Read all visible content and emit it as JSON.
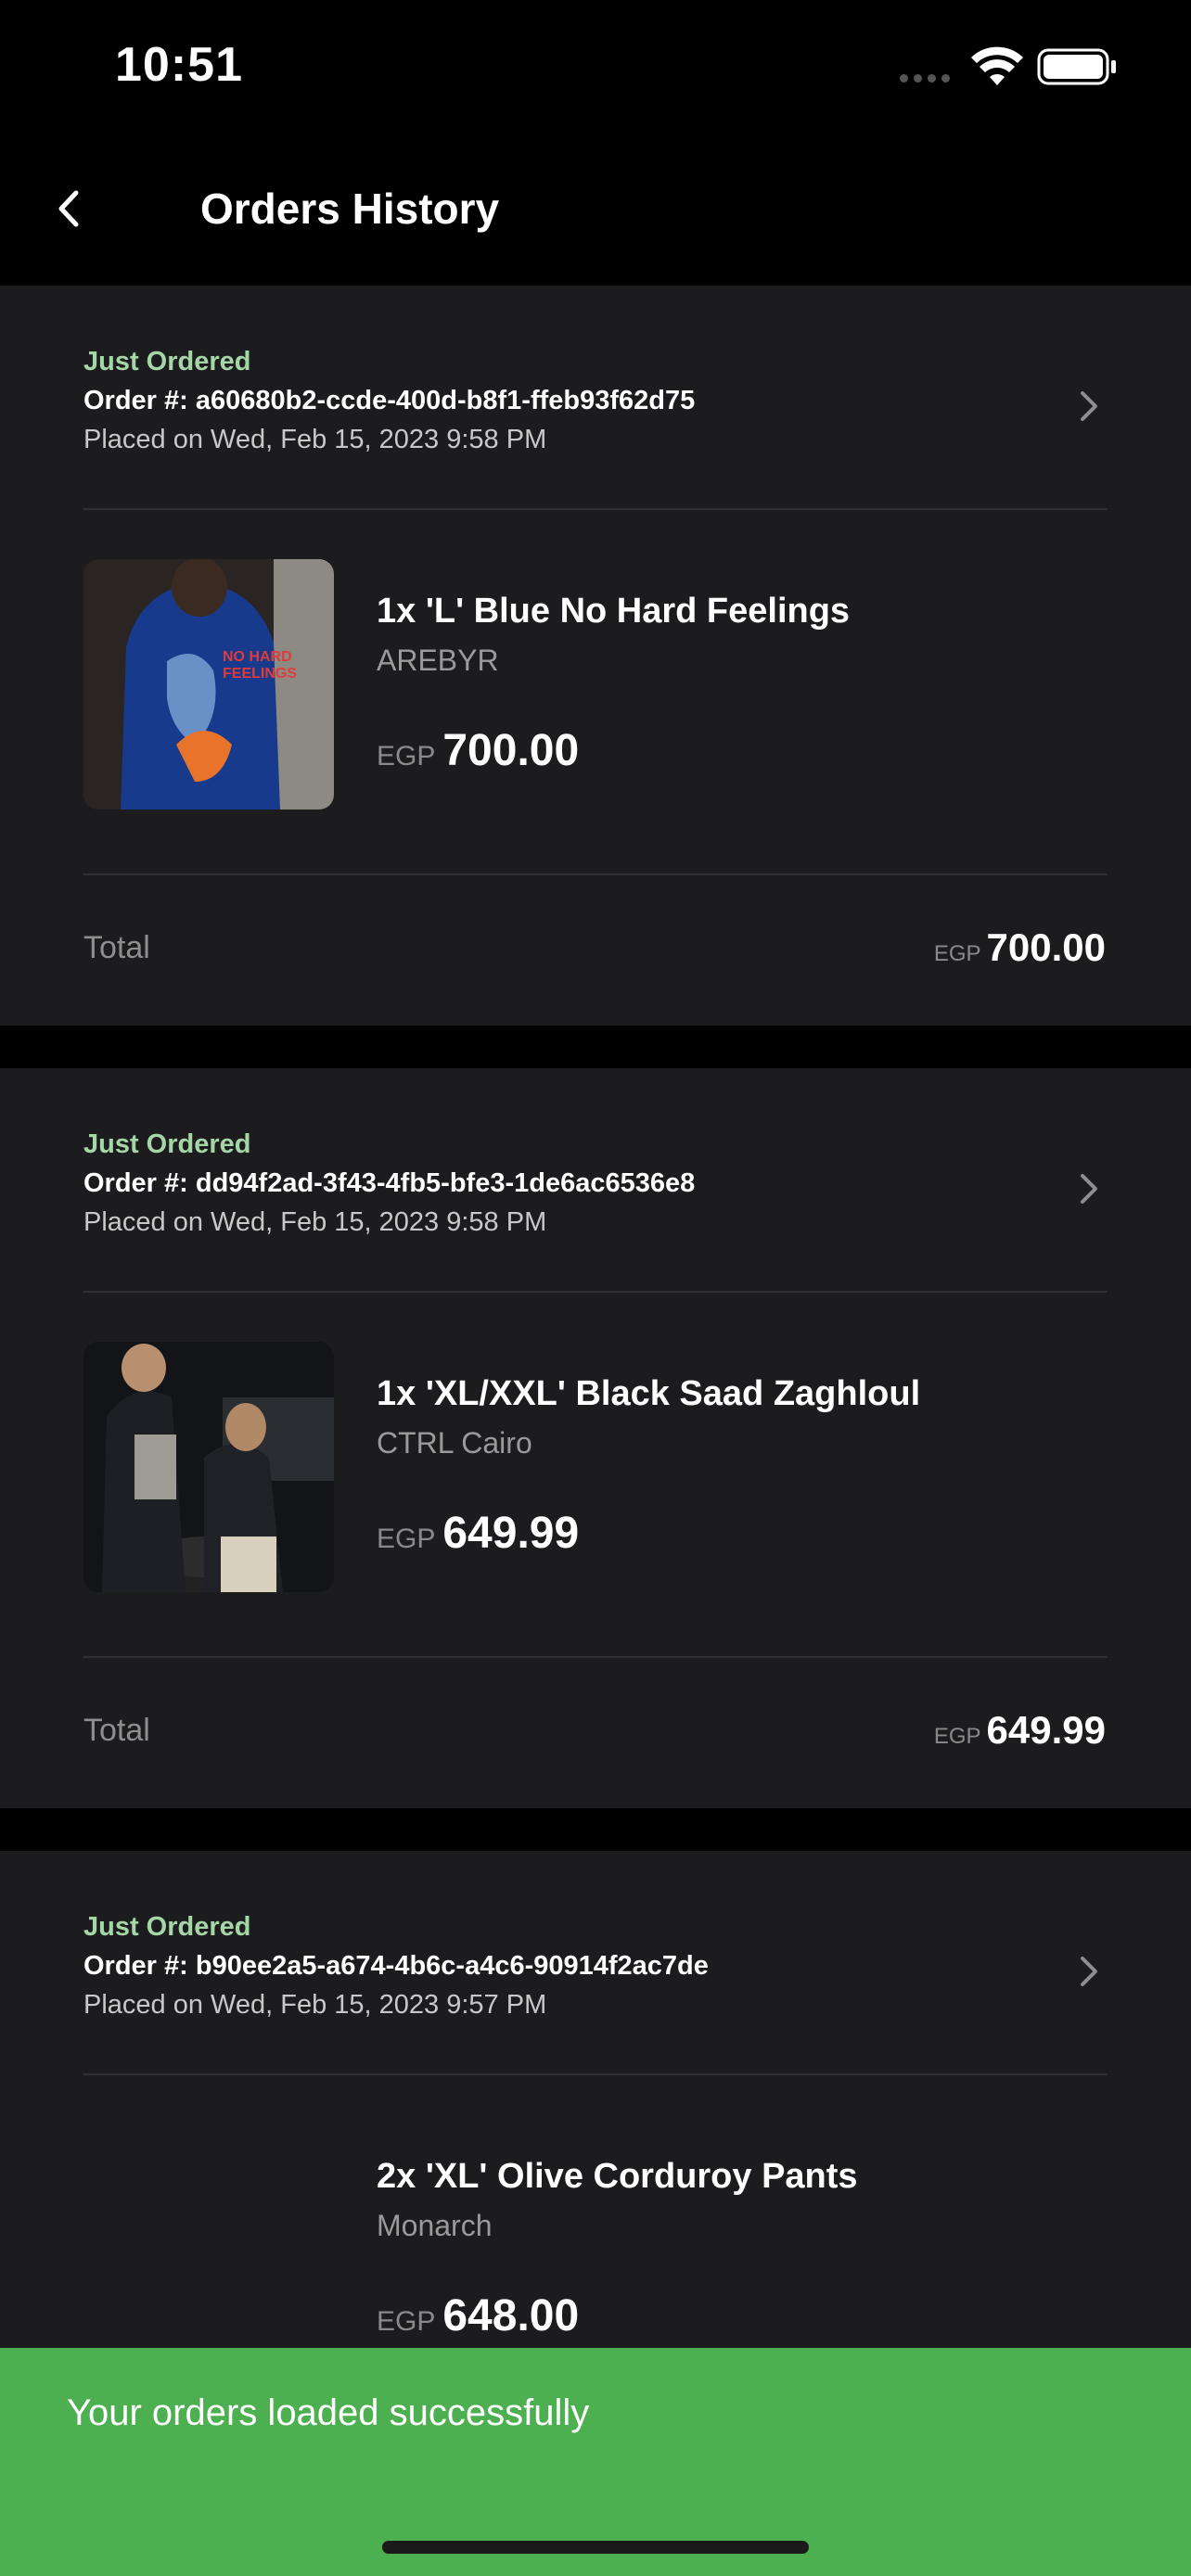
{
  "status_bar": {
    "time": "10:51"
  },
  "header": {
    "title": "Orders History"
  },
  "colors": {
    "status_green": "#a5d6a7",
    "toast_bg": "#4caf50",
    "card_bg": "#1c1c1e"
  },
  "orders": [
    {
      "status": "Just Ordered",
      "order_number": "Order #: a60680b2-ccde-400d-b8f1-ffeb93f62d75",
      "placed_on": "Placed on Wed, Feb 15, 2023 9:58 PM",
      "item": {
        "title": "1x 'L' Blue No Hard Feelings",
        "brand": "AREBYR",
        "currency": "EGP",
        "price": "700.00"
      },
      "total_label": "Total",
      "total_currency": "EGP",
      "total": "700.00"
    },
    {
      "status": "Just Ordered",
      "order_number": "Order #: dd94f2ad-3f43-4fb5-bfe3-1de6ac6536e8",
      "placed_on": "Placed on Wed, Feb 15, 2023 9:58 PM",
      "item": {
        "title": "1x 'XL/XXL' Black Saad Zaghloul",
        "brand": "CTRL Cairo",
        "currency": "EGP",
        "price": "649.99"
      },
      "total_label": "Total",
      "total_currency": "EGP",
      "total": "649.99"
    },
    {
      "status": "Just Ordered",
      "order_number": "Order #: b90ee2a5-a674-4b6c-a4c6-90914f2ac7de",
      "placed_on": "Placed on Wed, Feb 15, 2023 9:57 PM",
      "item": {
        "title": "2x 'XL' Olive Corduroy Pants",
        "brand": "Monarch",
        "currency": "EGP",
        "price": "648.00"
      }
    }
  ],
  "toast": {
    "message": "Your orders loaded successfully"
  }
}
